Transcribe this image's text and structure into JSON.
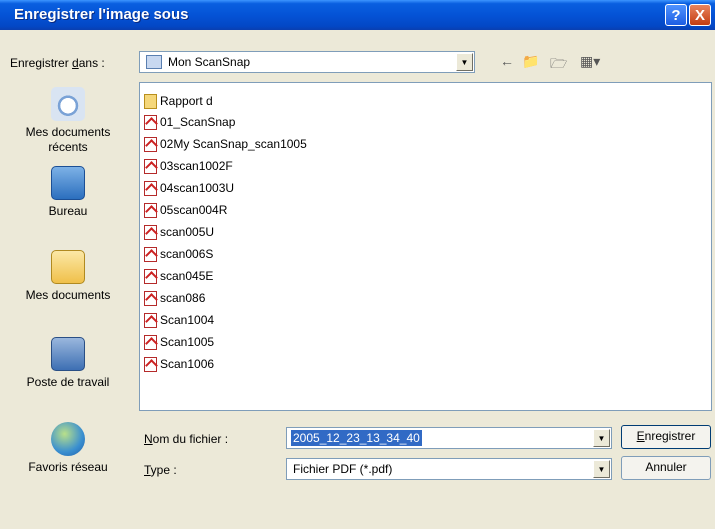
{
  "window": {
    "title": "Enregistrer l'image sous",
    "help_label": "?",
    "close_label": "X"
  },
  "lookin": {
    "label_prefix": "Enregistrer ",
    "label_accel": "d",
    "label_suffix": "ans :",
    "value": "Mon ScanSnap",
    "dropdown_icon": "▼"
  },
  "toolbar": {
    "back_icon": "back-arrow-icon",
    "up_icon": "up-folder-icon",
    "newfolder_icon": "new-folder-icon",
    "view_icon": "view-menu-icon"
  },
  "places": [
    {
      "label": "Mes documents récents",
      "icon": "recent-documents-icon"
    },
    {
      "label": "Bureau",
      "icon": "desktop-icon"
    },
    {
      "label": "Mes documents",
      "icon": "my-documents-icon"
    },
    {
      "label": "Poste de travail",
      "icon": "my-computer-icon"
    },
    {
      "label": "Favoris réseau",
      "icon": "network-places-icon"
    }
  ],
  "files": [
    {
      "name": "Rapport d",
      "kind": "folder"
    },
    {
      "name": "01_ScanSnap",
      "kind": "pdf"
    },
    {
      "name": "02My ScanSnap_scan1005",
      "kind": "pdf"
    },
    {
      "name": "03scan1002F",
      "kind": "pdf"
    },
    {
      "name": "04scan1003U",
      "kind": "pdf"
    },
    {
      "name": "05scan004R",
      "kind": "pdf"
    },
    {
      "name": "scan005U",
      "kind": "pdf"
    },
    {
      "name": "scan006S",
      "kind": "pdf"
    },
    {
      "name": "scan045E",
      "kind": "pdf"
    },
    {
      "name": "scan086",
      "kind": "pdf"
    },
    {
      "name": "Scan1004",
      "kind": "pdf"
    },
    {
      "name": "Scan1005",
      "kind": "pdf"
    },
    {
      "name": "Scan1006",
      "kind": "pdf"
    }
  ],
  "filename": {
    "label_accel": "N",
    "label_rest": "om du fichier :",
    "value": "2005_12_23_13_34_40"
  },
  "filetype": {
    "label_accel": "T",
    "label_rest": "ype :",
    "value": "Fichier PDF (*.pdf)"
  },
  "buttons": {
    "save_accel": "E",
    "save_rest": "nregistrer",
    "cancel": "Annuler"
  }
}
